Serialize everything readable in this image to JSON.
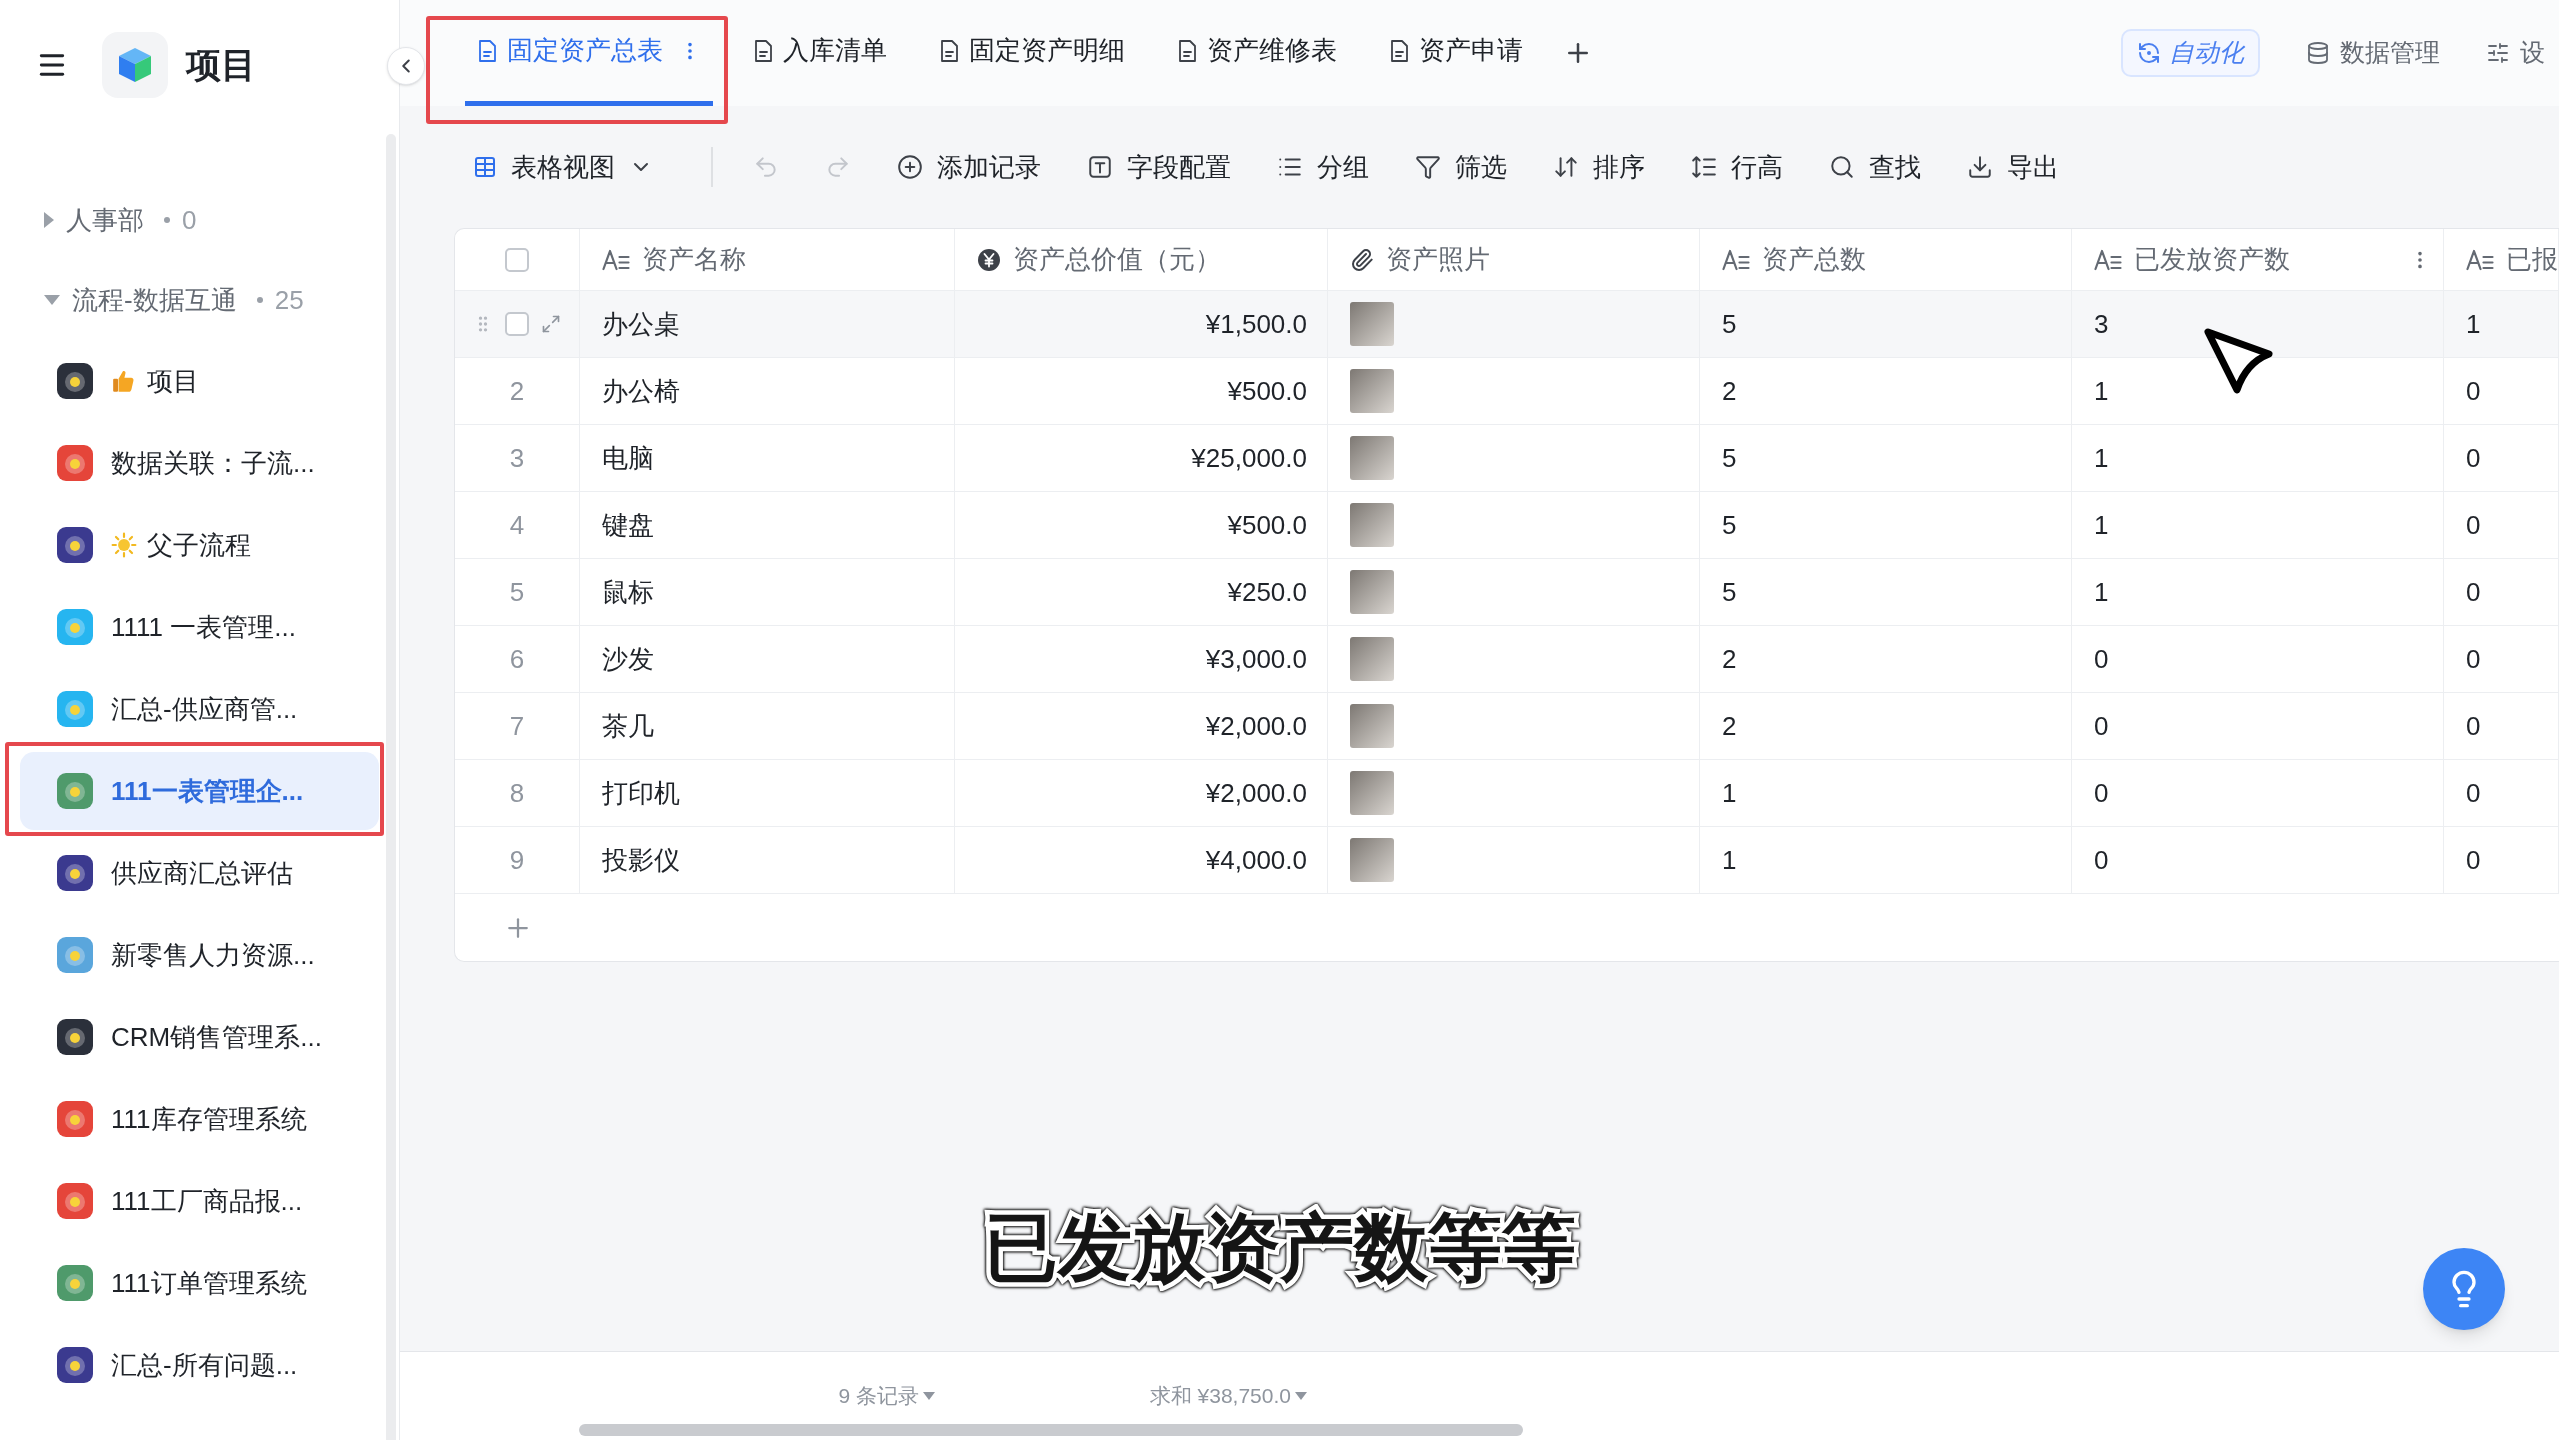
{
  "sidebar": {
    "title": "项目",
    "groups": [
      {
        "label": "人事部",
        "count": "0",
        "expanded": false
      },
      {
        "label": "流程-数据互通",
        "count": "25",
        "expanded": true,
        "children": [
          {
            "label": "项目",
            "kind": "thumbs",
            "color": "#2b303b",
            "selected": false,
            "highlight_frame": false
          },
          {
            "label": "数据关联：子流...",
            "kind": "plain",
            "color": "#e5453a",
            "selected": false,
            "highlight_frame": false
          },
          {
            "label": "父子流程",
            "kind": "sun",
            "color": "#3b3a8f",
            "selected": false,
            "highlight_frame": false
          },
          {
            "label": "1111 一表管理...",
            "kind": "plain",
            "color": "#26b5f0",
            "selected": false,
            "highlight_frame": false
          },
          {
            "label": "汇总-供应商管...",
            "kind": "plain",
            "color": "#26b5f0",
            "selected": false,
            "highlight_frame": false
          },
          {
            "label": "111一表管理企...",
            "kind": "plain",
            "color": "#4f9a6b",
            "selected": true,
            "highlight_frame": true
          },
          {
            "label": "供应商汇总评估",
            "kind": "plain",
            "color": "#3b3a8f",
            "selected": false,
            "highlight_frame": false
          },
          {
            "label": "新零售人力资源...",
            "kind": "plain",
            "color": "#5aa6dc",
            "selected": false,
            "highlight_frame": false
          },
          {
            "label": "CRM销售管理系...",
            "kind": "plain",
            "color": "#2b303b",
            "selected": false,
            "highlight_frame": false
          },
          {
            "label": "111库存管理系统",
            "kind": "plain",
            "color": "#e5453a",
            "selected": false,
            "highlight_frame": false
          },
          {
            "label": "111工厂商品报...",
            "kind": "plain",
            "color": "#e5453a",
            "selected": false,
            "highlight_frame": false
          },
          {
            "label": "111订单管理系统",
            "kind": "plain",
            "color": "#4f9a6b",
            "selected": false,
            "highlight_frame": false
          },
          {
            "label": "汇总-所有问题...",
            "kind": "plain",
            "color": "#3b3a8f",
            "selected": false,
            "highlight_frame": false
          }
        ]
      }
    ]
  },
  "tabs": [
    {
      "label": "固定资产总表",
      "selected": true,
      "highlight_frame": true
    },
    {
      "label": "入库清单",
      "selected": false,
      "highlight_frame": false
    },
    {
      "label": "固定资产明细",
      "selected": false,
      "highlight_frame": false
    },
    {
      "label": "资产维修表",
      "selected": false,
      "highlight_frame": false
    },
    {
      "label": "资产申请",
      "selected": false,
      "highlight_frame": false
    }
  ],
  "header_actions": [
    {
      "kind": "automation",
      "label": "自动化"
    },
    {
      "kind": "data",
      "label": "数据管理"
    },
    {
      "kind": "settings",
      "label": "设"
    }
  ],
  "toolbar": {
    "view": "表格视图",
    "history": [
      {
        "kind": "undo",
        "disabled": true
      },
      {
        "kind": "redo",
        "disabled": true
      }
    ],
    "actions": [
      {
        "kind": "add",
        "label": "添加记录"
      },
      {
        "kind": "fields",
        "label": "字段配置"
      },
      {
        "kind": "group",
        "label": "分组"
      },
      {
        "kind": "filter",
        "label": "筛选"
      },
      {
        "kind": "sort",
        "label": "排序"
      },
      {
        "kind": "row_height",
        "label": "行高"
      },
      {
        "kind": "search",
        "label": "查找"
      },
      {
        "kind": "export",
        "label": "导出"
      }
    ]
  },
  "table": {
    "select_all": {
      "checked": false
    },
    "columns": [
      {
        "kind": "text",
        "label": "资产名称",
        "menu": false
      },
      {
        "kind": "currency",
        "label": "资产总价值（元）",
        "menu": false
      },
      {
        "kind": "attachment",
        "label": "资产照片",
        "menu": false
      },
      {
        "kind": "text",
        "label": "资产总数",
        "menu": false
      },
      {
        "kind": "text",
        "label": "已发放资产数",
        "menu": true
      },
      {
        "kind": "text",
        "label": "已报",
        "menu": false
      }
    ],
    "rows": [
      {
        "hovered": true,
        "checked": false,
        "cells": [
          {
            "text": "办公桌"
          },
          {
            "text": "¥1,500.0"
          },
          {
            "photo": true
          },
          {
            "text": "5"
          },
          {
            "text": "3"
          },
          {
            "text": "1"
          }
        ]
      },
      {
        "index": "2",
        "hovered": false,
        "checked": false,
        "cells": [
          {
            "text": "办公椅"
          },
          {
            "text": "¥500.0"
          },
          {
            "photo": true
          },
          {
            "text": "2"
          },
          {
            "text": "1"
          },
          {
            "text": "0"
          }
        ]
      },
      {
        "index": "3",
        "hovered": false,
        "checked": false,
        "cells": [
          {
            "text": "电脑"
          },
          {
            "text": "¥25,000.0"
          },
          {
            "photo": true
          },
          {
            "text": "5"
          },
          {
            "text": "1"
          },
          {
            "text": "0"
          }
        ]
      },
      {
        "index": "4",
        "hovered": false,
        "checked": false,
        "cells": [
          {
            "text": "键盘"
          },
          {
            "text": "¥500.0"
          },
          {
            "photo": true
          },
          {
            "text": "5"
          },
          {
            "text": "1"
          },
          {
            "text": "0"
          }
        ]
      },
      {
        "index": "5",
        "hovered": false,
        "checked": false,
        "cells": [
          {
            "text": "鼠标"
          },
          {
            "text": "¥250.0"
          },
          {
            "photo": true
          },
          {
            "text": "5"
          },
          {
            "text": "1"
          },
          {
            "text": "0"
          }
        ]
      },
      {
        "index": "6",
        "hovered": false,
        "checked": false,
        "cells": [
          {
            "text": "沙发"
          },
          {
            "text": "¥3,000.0"
          },
          {
            "photo": true
          },
          {
            "text": "2"
          },
          {
            "text": "0"
          },
          {
            "text": "0"
          }
        ]
      },
      {
        "index": "7",
        "hovered": false,
        "checked": false,
        "cells": [
          {
            "text": "茶几"
          },
          {
            "text": "¥2,000.0"
          },
          {
            "photo": true
          },
          {
            "text": "2"
          },
          {
            "text": "0"
          },
          {
            "text": "0"
          }
        ]
      },
      {
        "index": "8",
        "hovered": false,
        "checked": false,
        "cells": [
          {
            "text": "打印机"
          },
          {
            "text": "¥2,000.0"
          },
          {
            "photo": true
          },
          {
            "text": "1"
          },
          {
            "text": "0"
          },
          {
            "text": "0"
          }
        ]
      },
      {
        "index": "9",
        "hovered": false,
        "checked": false,
        "cells": [
          {
            "text": "投影仪"
          },
          {
            "text": "¥4,000.0"
          },
          {
            "photo": true
          },
          {
            "text": "1"
          },
          {
            "text": "0"
          },
          {
            "text": "0"
          }
        ]
      }
    ],
    "footer": {
      "count": "9 条记录",
      "sum": "求和 ¥38,750.0"
    }
  },
  "caption": "已发放资产数等等"
}
